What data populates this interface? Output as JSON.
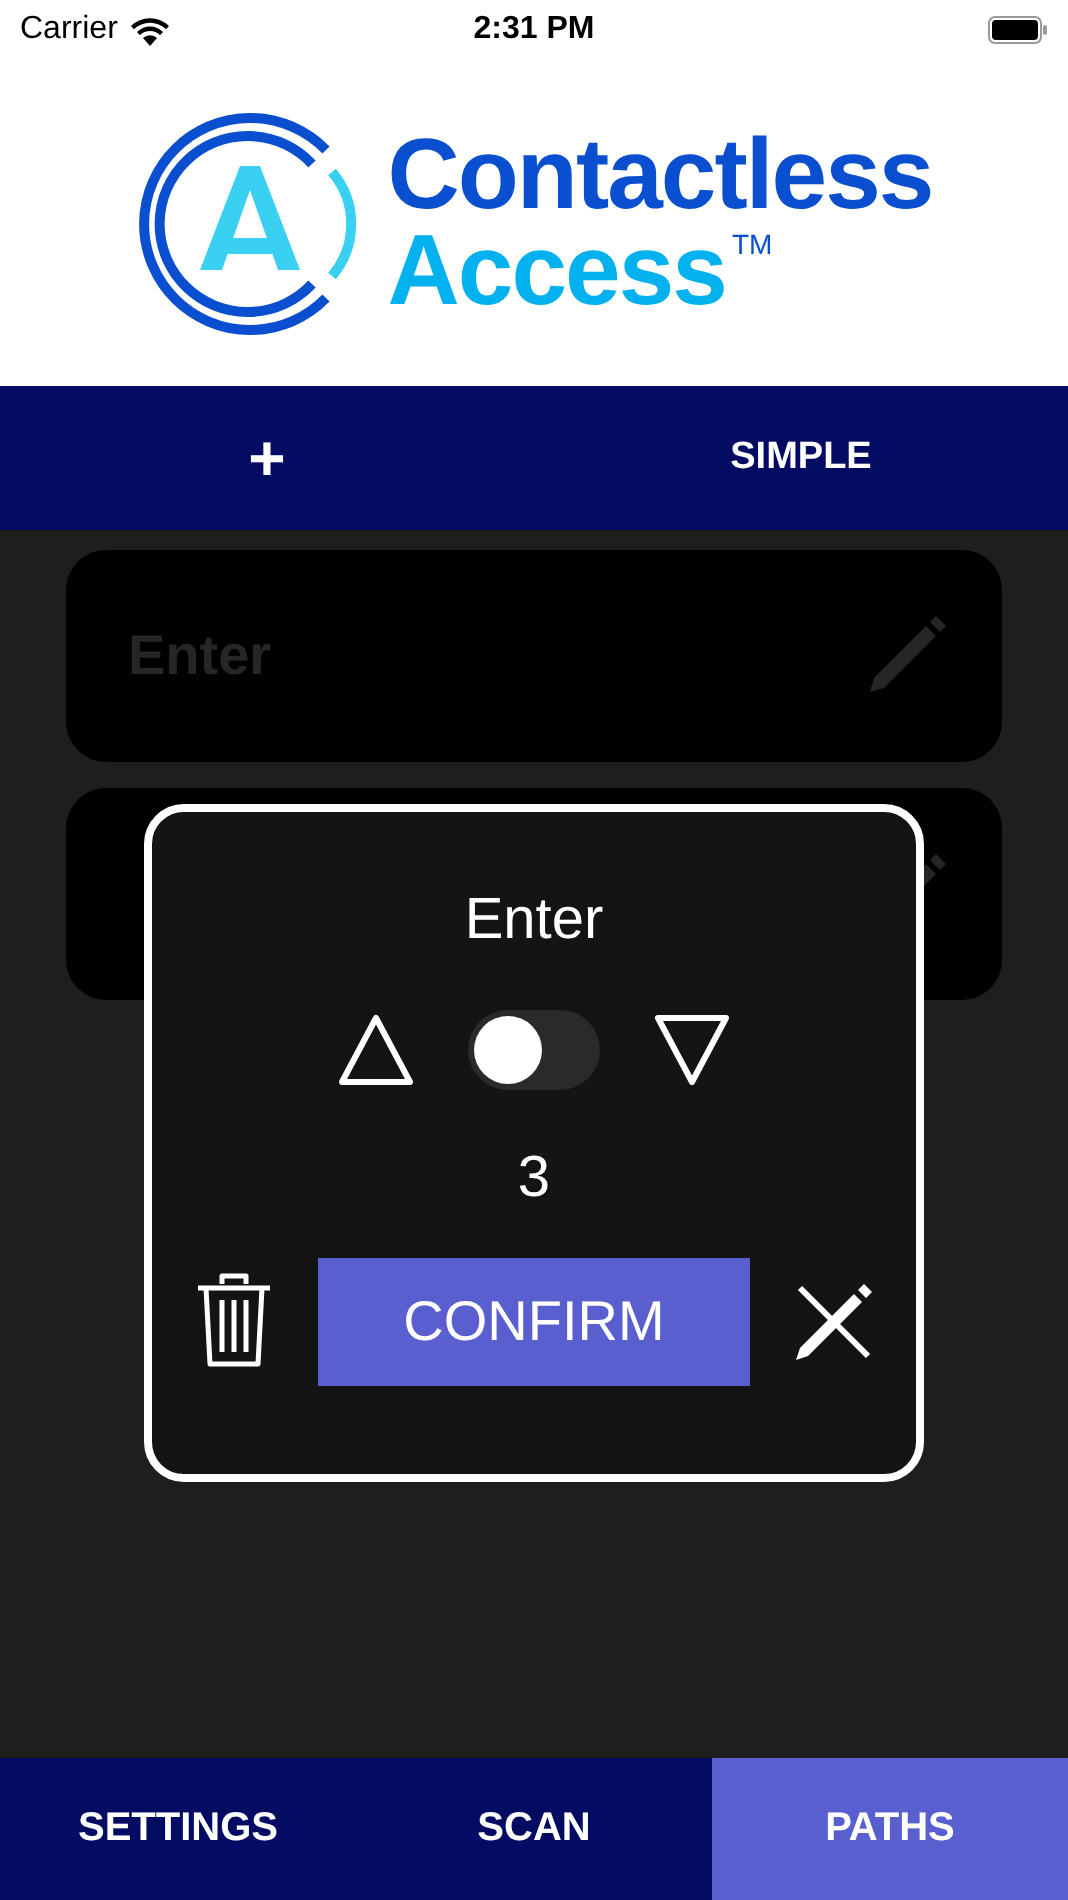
{
  "status_bar": {
    "carrier": "Carrier",
    "time": "2:31 PM"
  },
  "logo": {
    "line_1": "Contactless",
    "line_2": "Access",
    "trademark": "TM"
  },
  "toolbar": {
    "add": "+",
    "mode": "SIMPLE"
  },
  "paths": [
    {
      "kind": "path",
      "label": "Enter"
    },
    {
      "kind": "path"
    }
  ],
  "dialog": {
    "title": "Enter",
    "toggle": {
      "on": false
    },
    "count": "3",
    "confirm": "CONFIRM"
  },
  "tabs": [
    {
      "label": "SETTINGS",
      "selected": false
    },
    {
      "label": "SCAN",
      "selected": false
    },
    {
      "label": "PATHS",
      "selected": true
    }
  ]
}
